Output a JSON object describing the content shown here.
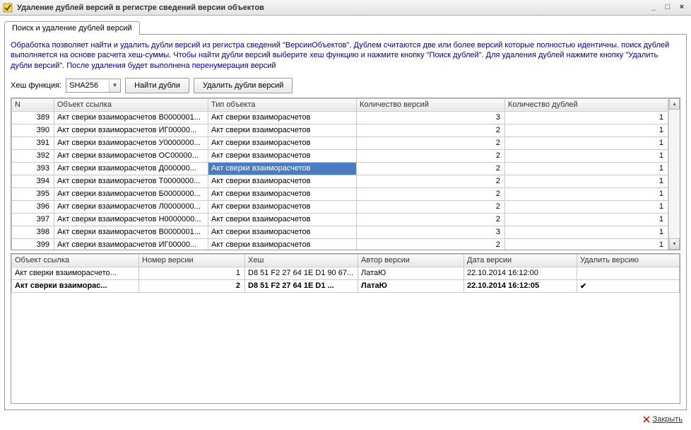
{
  "window": {
    "title": "Удаление дублей версий в регистре сведений версии объектов"
  },
  "tab": {
    "label": "Поиск и удаление дублей версий"
  },
  "description": "Обработка позволяет найти и удалить дубли версий из регистра сведений \"ВерсииОбъектов\". Дублем считаются две или более версий которые полностью идентичны. поиск дублей выполняется на основе расчета хеш-суммы. Чтобы найти дубли версий выберите хеш функцию и нажмите кнопку \"Поиск дублей\". Для удаления дублей нажмите кнопку \"Удалить дубли версий\". После удаления будет выполнена перенумерация версий",
  "hash": {
    "label": "Хеш функция:",
    "value": "SHA256"
  },
  "buttons": {
    "find": "Найти дубли",
    "delete": "Удалить дубли версий",
    "close": "Закрыть"
  },
  "grid1": {
    "headers": {
      "n": "N",
      "obj": "Объект ссылка",
      "type": "Тип объекта",
      "vers": "Количество версий",
      "dups": "Количество дублей"
    },
    "rows": [
      {
        "n": "389",
        "obj": "Акт сверки взаиморасчетов В0000001...",
        "type": "Акт сверки взаиморасчетов",
        "vers": "3",
        "dups": "1"
      },
      {
        "n": "390",
        "obj": "Акт сверки взаиморасчетов ИГ00000...",
        "type": "Акт сверки взаиморасчетов",
        "vers": "2",
        "dups": "1"
      },
      {
        "n": "391",
        "obj": "Акт сверки взаиморасчетов У0000000...",
        "type": "Акт сверки взаиморасчетов",
        "vers": "2",
        "dups": "1"
      },
      {
        "n": "392",
        "obj": "Акт сверки взаиморасчетов ОС00000...",
        "type": "Акт сверки взаиморасчетов",
        "vers": "2",
        "dups": "1"
      },
      {
        "n": "393",
        "obj": "Акт сверки взаиморасчетов Д000000...",
        "type": "Акт сверки взаиморасчетов",
        "vers": "2",
        "dups": "1",
        "selected": true
      },
      {
        "n": "394",
        "obj": "Акт сверки взаиморасчетов Т0000000...",
        "type": "Акт сверки взаиморасчетов",
        "vers": "2",
        "dups": "1"
      },
      {
        "n": "395",
        "obj": "Акт сверки взаиморасчетов Б0000000...",
        "type": "Акт сверки взаиморасчетов",
        "vers": "2",
        "dups": "1"
      },
      {
        "n": "396",
        "obj": "Акт сверки взаиморасчетов Л0000000...",
        "type": "Акт сверки взаиморасчетов",
        "vers": "2",
        "dups": "1"
      },
      {
        "n": "397",
        "obj": "Акт сверки взаиморасчетов Н0000000...",
        "type": "Акт сверки взаиморасчетов",
        "vers": "2",
        "dups": "1"
      },
      {
        "n": "398",
        "obj": "Акт сверки взаиморасчетов В0000001...",
        "type": "Акт сверки взаиморасчетов",
        "vers": "3",
        "dups": "1"
      },
      {
        "n": "399",
        "obj": "Акт сверки взаиморасчетов ИГ00000...",
        "type": "Акт сверки взаиморасчетов",
        "vers": "2",
        "dups": "1"
      }
    ]
  },
  "grid2": {
    "headers": {
      "obj": "Объект ссылка",
      "num": "Номер версии",
      "hash": "Хеш",
      "author": "Автор версии",
      "date": "Дата версии",
      "del": "Удалить версию"
    },
    "rows": [
      {
        "obj": "Акт сверки взаиморасчето...",
        "num": "1",
        "hash": "D8 51 F2 27 64 1E D1 90 67...",
        "author": "ЛатаЮ",
        "date": "22.10.2014 16:12:00",
        "del": ""
      },
      {
        "obj": "Акт сверки взаиморас...",
        "num": "2",
        "hash": "D8 51 F2 27 64 1E D1 ...",
        "author": "ЛатаЮ",
        "date": "22.10.2014 16:12:05",
        "del": "✔",
        "bold": true
      }
    ]
  }
}
